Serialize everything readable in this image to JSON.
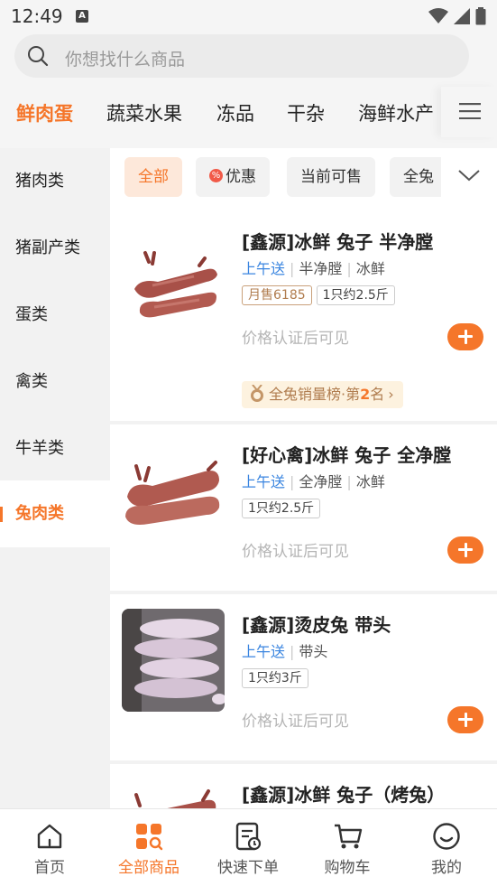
{
  "status_bar": {
    "time": "12:49",
    "notification_badge": "A"
  },
  "search": {
    "placeholder": "你想找什么商品"
  },
  "category_tabs": [
    {
      "label": "鲜肉蛋",
      "active": true
    },
    {
      "label": "蔬菜水果",
      "active": false
    },
    {
      "label": "冻品",
      "active": false
    },
    {
      "label": "干杂",
      "active": false
    },
    {
      "label": "海鲜水产",
      "active": false
    }
  ],
  "sidebar": {
    "items": [
      {
        "label": "猪肉类",
        "active": false
      },
      {
        "label": "猪副产类",
        "active": false
      },
      {
        "label": "蛋类",
        "active": false
      },
      {
        "label": "禽类",
        "active": false
      },
      {
        "label": "牛羊类",
        "active": false
      },
      {
        "label": "兔肉类",
        "active": true
      }
    ]
  },
  "filters": [
    {
      "label": "全部",
      "active": true
    },
    {
      "label": "优惠",
      "icon": "%",
      "active": false
    },
    {
      "label": "当前可售",
      "active": false
    },
    {
      "label": "全兔",
      "active": false
    }
  ],
  "products": [
    {
      "title": "[鑫源]冰鲜 兔子 半净膛",
      "delivery": "上午送",
      "tags": [
        "半净膛",
        "冰鲜"
      ],
      "sales": "月售6185",
      "spec": "1只约2.5斤",
      "price_note": "价格认证后可见",
      "rank_prefix": "全兔销量榜·第",
      "rank_num": "2",
      "rank_suffix": "名"
    },
    {
      "title": "[好心禽]冰鲜 兔子 全净膛",
      "delivery": "上午送",
      "tags": [
        "全净膛",
        "冰鲜"
      ],
      "spec": "1只约2.5斤",
      "price_note": "价格认证后可见"
    },
    {
      "title": "[鑫源]烫皮兔 带头",
      "delivery": "上午送",
      "tags": [
        "带头"
      ],
      "spec": "1只约3斤",
      "price_note": "价格认证后可见"
    },
    {
      "title": "[鑫源]冰鲜 兔子（烤兔）"
    }
  ],
  "bottom_nav": [
    {
      "label": "首页",
      "icon": "home-icon",
      "active": false
    },
    {
      "label": "全部商品",
      "icon": "category-icon",
      "active": true
    },
    {
      "label": "快速下单",
      "icon": "quick-order-icon",
      "active": false
    },
    {
      "label": "购物车",
      "icon": "cart-icon",
      "active": false
    },
    {
      "label": "我的",
      "icon": "profile-icon",
      "active": false
    }
  ],
  "colors": {
    "accent": "#f5762a",
    "blue": "#3b86e0",
    "sidebar_bg": "#f2f2f2"
  }
}
